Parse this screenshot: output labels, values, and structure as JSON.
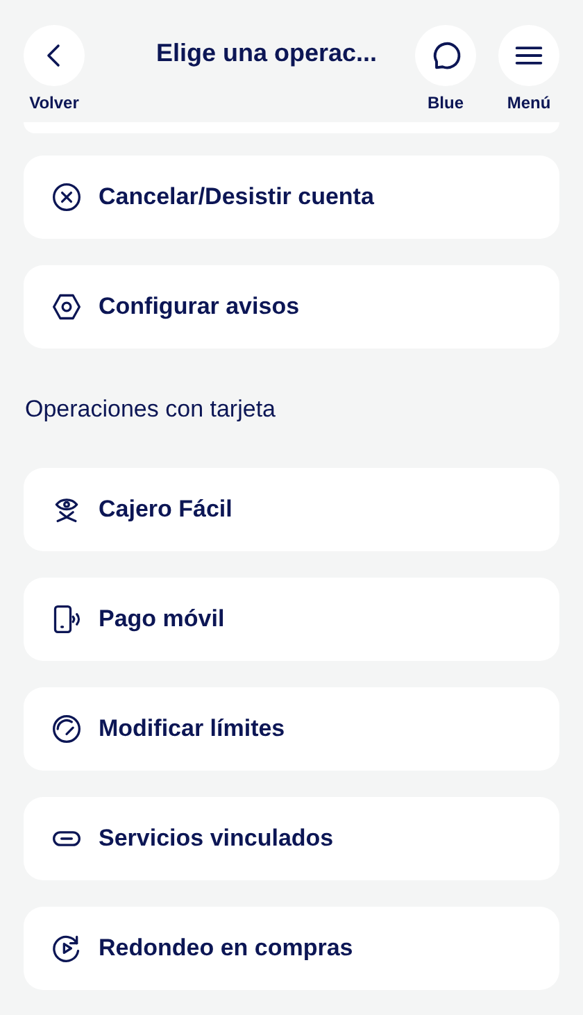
{
  "header": {
    "back": {
      "label": "Volver"
    },
    "title": "Elige una operac...",
    "actions": [
      {
        "kind": "chat",
        "label": "Blue"
      },
      {
        "kind": "menu",
        "label": "Menú"
      }
    ]
  },
  "groups": [
    {
      "items": [
        {
          "kind": "cancel",
          "label": "Cancelar/Desistir cuenta"
        },
        {
          "kind": "settings",
          "label": "Configurar avisos"
        }
      ]
    },
    {
      "title": "Operaciones con tarjeta",
      "items": [
        {
          "kind": "atm",
          "label": "Cajero Fácil"
        },
        {
          "kind": "mobile-pay",
          "label": "Pago móvil"
        },
        {
          "kind": "gauge",
          "label": "Modificar límites"
        },
        {
          "kind": "link",
          "label": "Servicios vinculados"
        },
        {
          "kind": "rounding",
          "label": "Redondeo en compras"
        }
      ]
    }
  ]
}
